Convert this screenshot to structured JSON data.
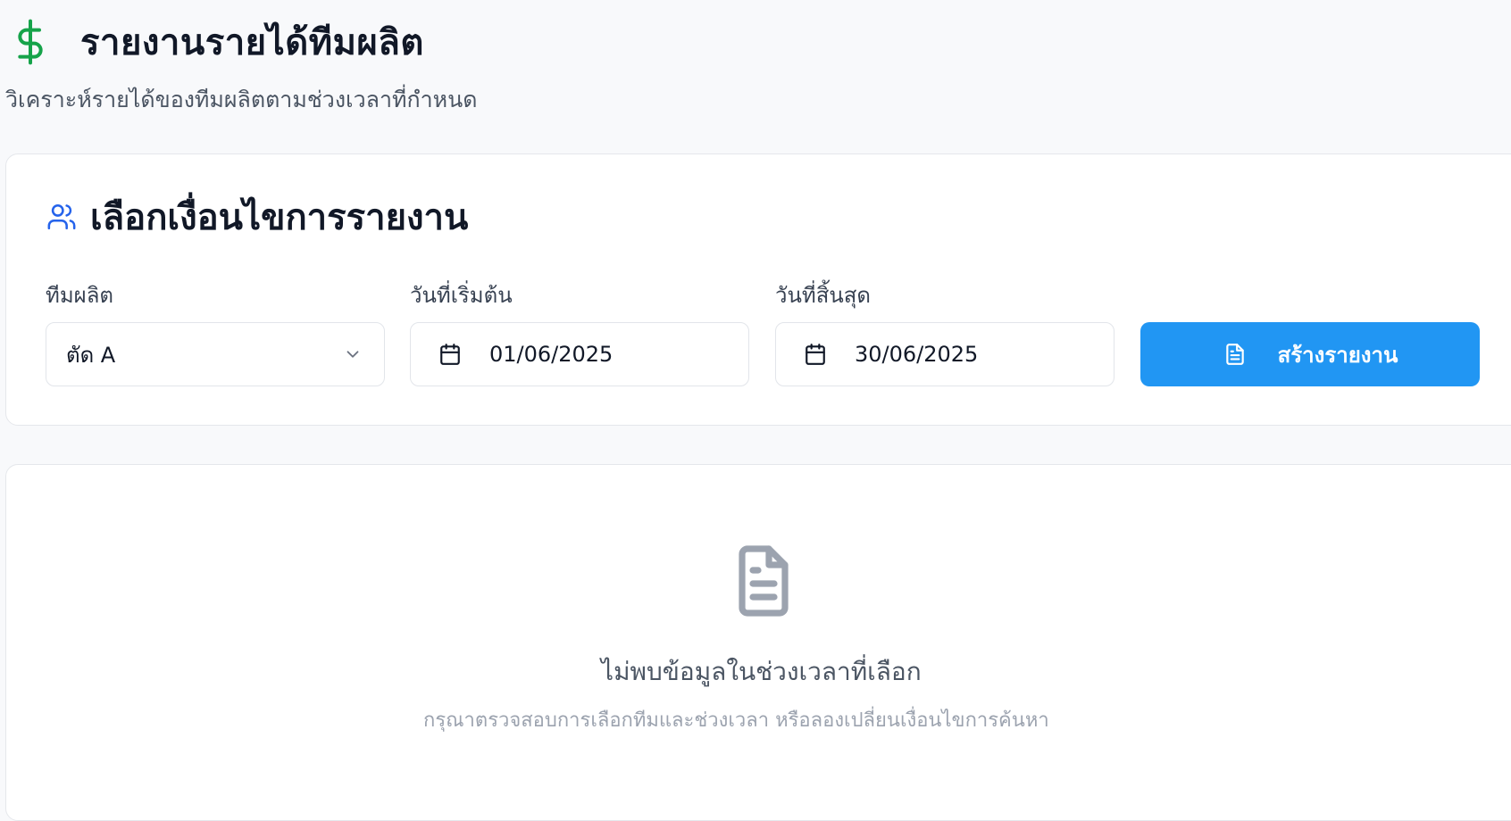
{
  "header": {
    "icon": "dollar-sign-icon",
    "title": "รายงานรายได้ทีมผลิต",
    "subtitle": "วิเคราะห์รายได้ของทีมผลิตตามช่วงเวลาที่กำหนด",
    "icon_color": "#16a34a"
  },
  "filters": {
    "icon": "users-icon",
    "title": "เลือกเงื่อนไขการรายงาน",
    "team": {
      "label": "ทีมผลิต",
      "value": "ตัด A",
      "icon": "chevron-down-icon"
    },
    "start_date": {
      "label": "วันที่เริ่มต้น",
      "value": "01/06/2025",
      "icon": "calendar-icon"
    },
    "end_date": {
      "label": "วันที่สิ้นสุด",
      "value": "30/06/2025",
      "icon": "calendar-icon"
    },
    "create_button": {
      "label": "สร้างรายงาน",
      "icon": "file-text-icon",
      "color": "#2196f3"
    }
  },
  "results": {
    "empty_icon": "file-text-icon",
    "empty_title": "ไม่พบข้อมูลในช่วงเวลาที่เลือก",
    "empty_description": "กรุณาตรวจสอบการเลือกทีมและช่วงเวลา หรือลองเปลี่ยนเงื่อนไขการค้นหา"
  }
}
